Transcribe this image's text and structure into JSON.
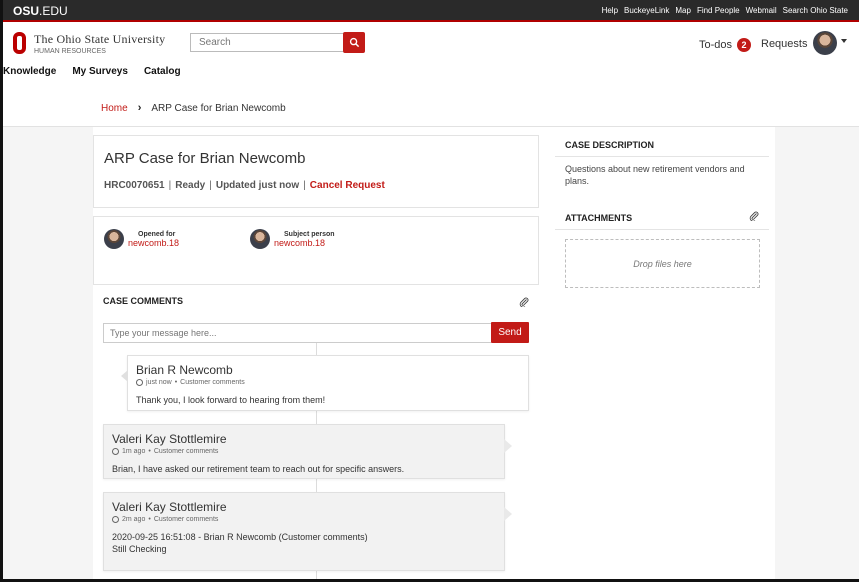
{
  "osubar": {
    "logo_main": "OSU",
    "logo_suffix": ".EDU",
    "links": [
      "Help",
      "BuckeyeLink",
      "Map",
      "Find People",
      "Webmail",
      "Search Ohio State"
    ]
  },
  "header": {
    "university": "The Ohio State University",
    "unit": "Human Resources",
    "search_placeholder": "Search",
    "todos_label": "To-dos",
    "todos_count": "2",
    "requests_label": "Requests"
  },
  "nav": {
    "items": [
      "Knowledge",
      "My Surveys",
      "Catalog"
    ]
  },
  "breadcrumb": {
    "home": "Home",
    "separator": "›",
    "current": "ARP Case for Brian Newcomb"
  },
  "case": {
    "title": "ARP Case for Brian Newcomb",
    "number": "HRC0070651",
    "state": "Ready",
    "updated": "Updated just now",
    "cancel_label": "Cancel Request",
    "opened_for_label": "Opened for",
    "opened_for_value": "newcomb.18",
    "subject_label": "Subject person",
    "subject_value": "newcomb.18"
  },
  "comments": {
    "heading": "CASE COMMENTS",
    "input_placeholder": "Type your message here...",
    "send_label": "Send",
    "items": [
      {
        "author": "Brian R Newcomb",
        "time": "just now",
        "type": "Customer comments",
        "body": "Thank you, I look forward to hearing from them!"
      },
      {
        "author": "Valeri Kay Stottlemire",
        "time": "1m ago",
        "type": "Customer comments",
        "body": "Brian, I have asked our retirement team to reach out for specific answers."
      },
      {
        "author": "Valeri Kay Stottlemire",
        "time": "2m ago",
        "type": "Customer comments",
        "body_line1": "2020-09-25 16:51:08 - Brian R Newcomb (Customer comments)",
        "body_line2": "Still Checking"
      }
    ]
  },
  "sidebar": {
    "desc_heading": "CASE DESCRIPTION",
    "desc_text": "Questions about new retirement vendors and plans.",
    "attach_heading": "ATTACHMENTS",
    "drop_label": "Drop files here"
  },
  "colors": {
    "accent": "#c21b17",
    "topbar": "#2a2a2a"
  }
}
